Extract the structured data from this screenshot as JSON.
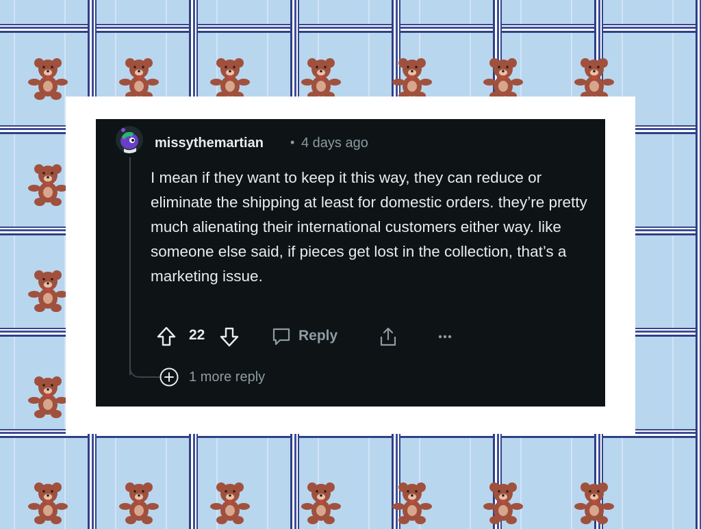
{
  "comment": {
    "username": "missythemartian",
    "separator": "•",
    "time_ago": "4 days ago",
    "body": "I mean if they want to keep it this way, they can reduce or eliminate the shipping at least for domestic orders. they’re pretty much alienating their international customers either way. like someone else said, if pieces get lost in the collection, that’s a marketing issue.",
    "upvote_icon": "arrow-up-icon",
    "vote_count": "22",
    "downvote_icon": "arrow-down-icon",
    "reply_label": "Reply",
    "reply_icon": "speech-bubble-icon",
    "share_icon": "share-icon",
    "more_icon": "ellipsis-icon",
    "more_replies_label": "1 more reply",
    "more_replies_icon": "plus-circle-icon"
  },
  "colors": {
    "comment_background": "#0e1416",
    "text": "#e7ecee",
    "muted_text": "#8e9ca2",
    "card": "#ffffff",
    "wallpaper": "#b9d6ef",
    "plaid": "#2f3f86",
    "bear": "#a0513d"
  }
}
